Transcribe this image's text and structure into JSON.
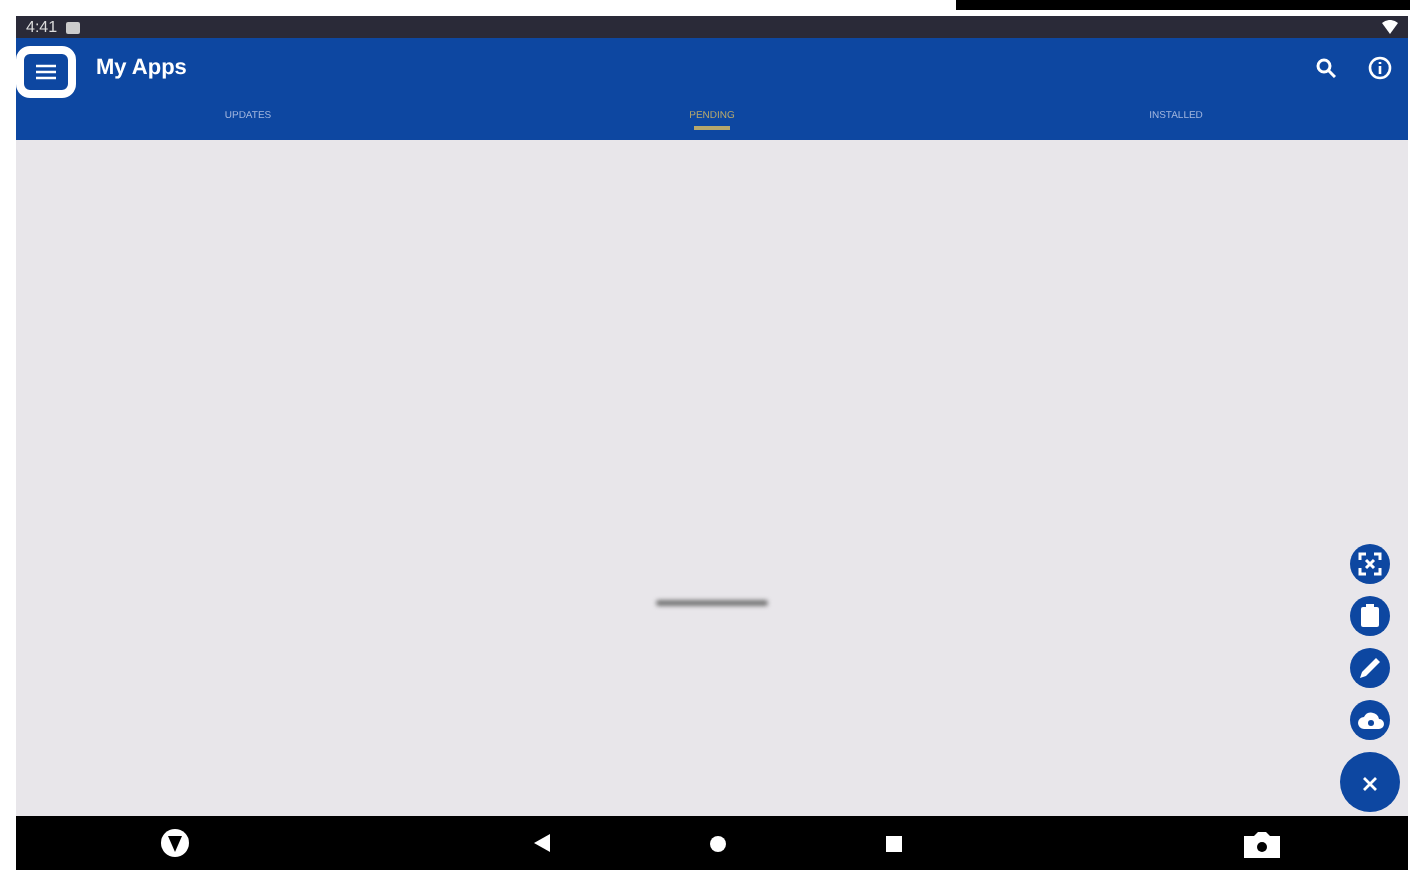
{
  "status_bar": {
    "time": "4:41"
  },
  "app_bar": {
    "title": "My Apps",
    "menu_highlighted": true
  },
  "tabs": [
    {
      "label": "UPDATES",
      "selected": false
    },
    {
      "label": "PENDING",
      "selected": true
    },
    {
      "label": "INSTALLED",
      "selected": false
    }
  ],
  "fab_menu": {
    "expanded": true,
    "actions": [
      {
        "kind": "scan"
      },
      {
        "kind": "clipboard"
      },
      {
        "kind": "edit"
      },
      {
        "kind": "cloud"
      }
    ]
  }
}
